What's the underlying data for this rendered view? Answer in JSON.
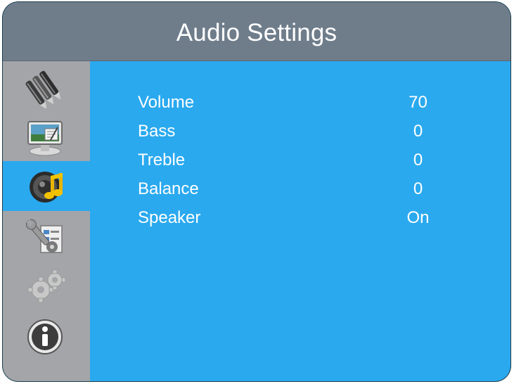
{
  "header": {
    "title": "Audio Settings"
  },
  "sidebar": {
    "items": [
      {
        "icon": "pens-icon",
        "active": false
      },
      {
        "icon": "picture-monitor-icon",
        "active": false
      },
      {
        "icon": "audio-speaker-icon",
        "active": true
      },
      {
        "icon": "tools-settings-icon",
        "active": false
      },
      {
        "icon": "gears-icon",
        "active": false
      },
      {
        "icon": "info-icon",
        "active": false
      }
    ]
  },
  "settings": [
    {
      "label": "Volume",
      "value": "70"
    },
    {
      "label": "Bass",
      "value": "0"
    },
    {
      "label": "Treble",
      "value": "0"
    },
    {
      "label": "Balance",
      "value": "0"
    },
    {
      "label": "Speaker",
      "value": "On"
    }
  ],
  "colors": {
    "header_bg": "#6f7d8b",
    "content_bg": "#2aa9ef",
    "sidebar_bg": "#a3a5a8",
    "text": "#ffffff"
  }
}
